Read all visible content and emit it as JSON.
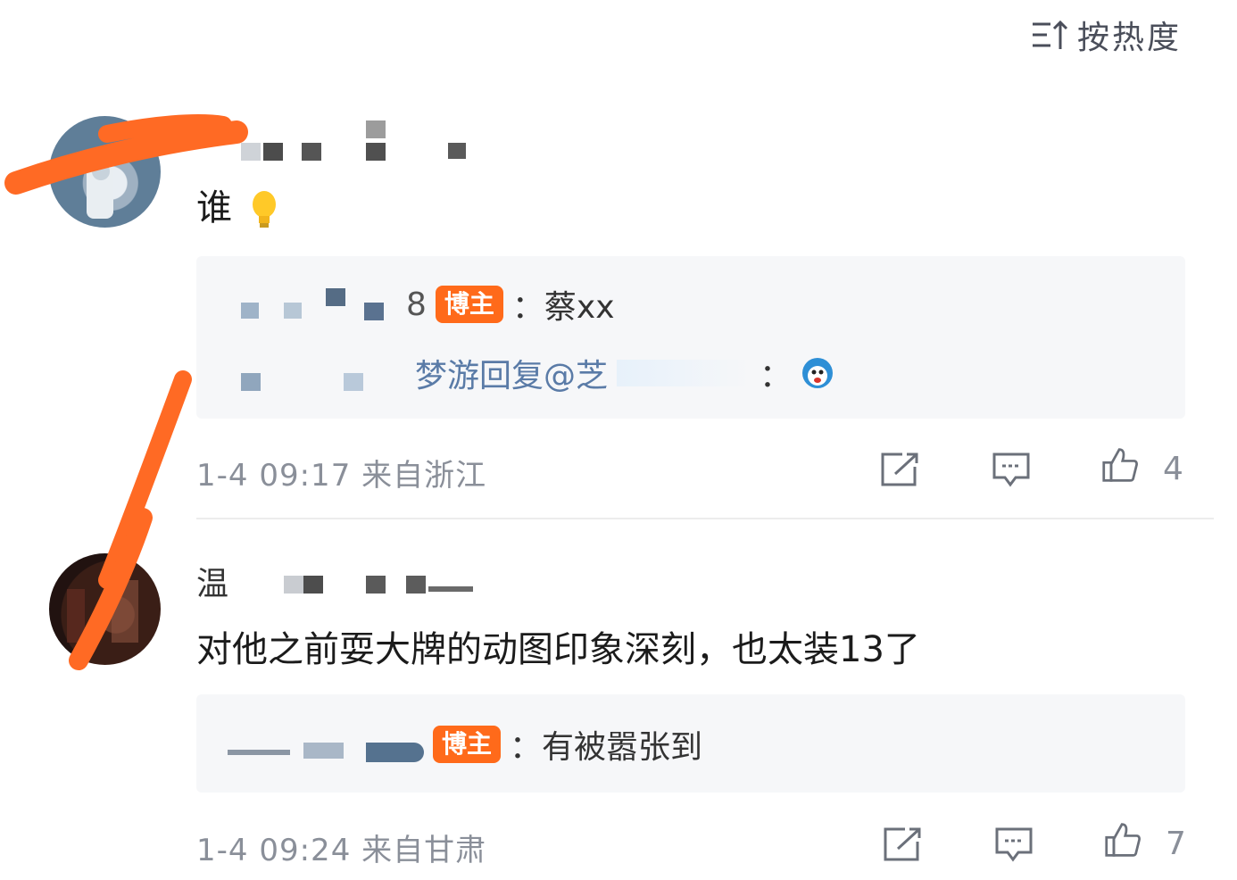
{
  "header": {
    "sort_label": "按热度",
    "sort_icon": "sort-lines-icon"
  },
  "comments": [
    {
      "username": "",
      "text": "谁",
      "emoji": "lightbulb-icon",
      "reply": {
        "author_badge": "博主",
        "author_tail": "8",
        "text": "：蔡xx",
        "sub_reply": "梦游回复@芝",
        "sub_reply_tail": "："
      },
      "meta": "1-4 09:17 来自浙江",
      "like_count": "4"
    },
    {
      "username": "温",
      "text": "对他之前耍大牌的动图印象深刻，也太装13了",
      "reply": {
        "author_badge": "博主",
        "text": "：有被嚣张到"
      },
      "meta": "1-4 09:24 来自甘肃",
      "like_count": "7"
    }
  ],
  "colors": {
    "badge": "#ff6a1a",
    "link": "#5a7ba7",
    "meta": "#8a8f99",
    "scribble": "#ff6a24"
  }
}
